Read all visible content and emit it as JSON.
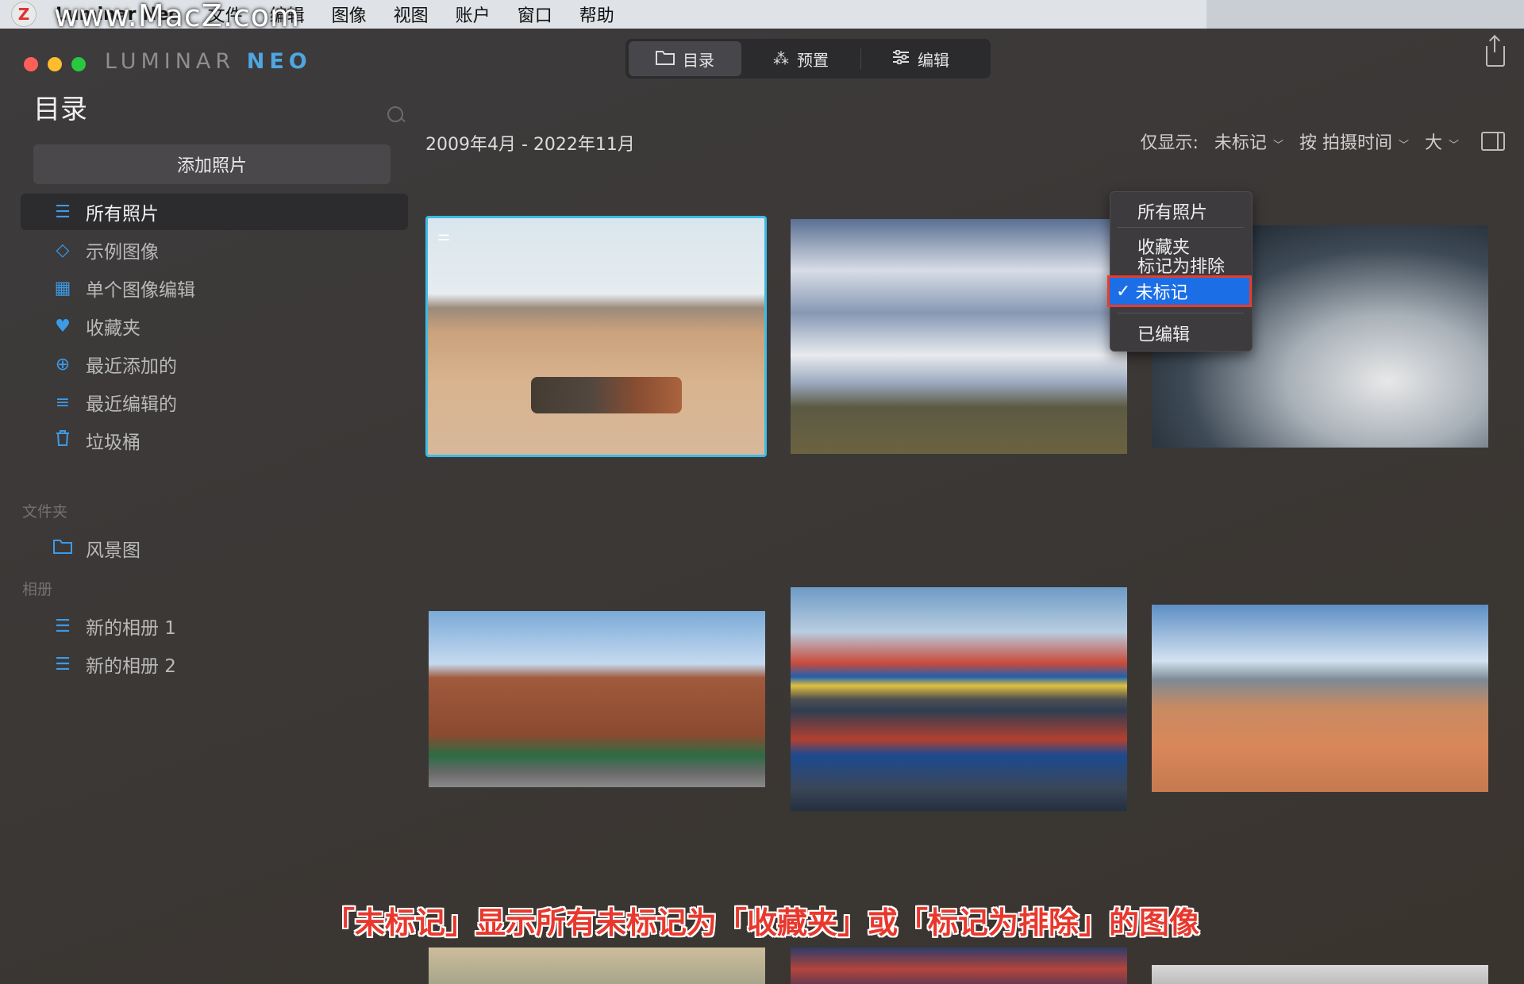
{
  "menubar": {
    "app_name": "Luminar Neo",
    "items": [
      "文件",
      "编辑",
      "图像",
      "视图",
      "账户",
      "窗口",
      "帮助"
    ]
  },
  "watermark": "www.MacZ.com",
  "brand": {
    "text": "LUMINAR",
    "accent": "NEO"
  },
  "topnav": {
    "catalog": "目录",
    "presets": "预置",
    "edit": "编辑"
  },
  "sidebar": {
    "title": "目录",
    "add_button": "添加照片",
    "items": [
      {
        "label": "所有照片",
        "icon": "stack-icon"
      },
      {
        "label": "示例图像",
        "icon": "graduation-cap-icon"
      },
      {
        "label": "单个图像编辑",
        "icon": "grid-icon"
      },
      {
        "label": "收藏夹",
        "icon": "heart-icon"
      },
      {
        "label": "最近添加的",
        "icon": "plus-circle-icon"
      },
      {
        "label": "最近编辑的",
        "icon": "sliders-icon"
      },
      {
        "label": "垃圾桶",
        "icon": "trash-icon"
      }
    ],
    "folders_label": "文件夹",
    "folders": [
      {
        "label": "风景图",
        "icon": "folder-icon"
      }
    ],
    "albums_label": "相册",
    "albums": [
      {
        "label": "新的相册 1",
        "icon": "album-icon"
      },
      {
        "label": "新的相册 2",
        "icon": "album-icon"
      }
    ]
  },
  "main": {
    "date_range": "2009年4月 - 2022年11月",
    "show_only_label": "仅显示:",
    "show_only_value": "未标记",
    "sort_label": "按 拍摄时间",
    "size_label": "大"
  },
  "dropdown": {
    "items": [
      "所有照片",
      "收藏夹",
      "标记为排除",
      "未标记",
      "已编辑"
    ],
    "selected": "未标记",
    "check": "✓"
  },
  "thumbnails": [
    {
      "name": "cows-desert",
      "selected": true,
      "edited": true
    },
    {
      "name": "clouds-field"
    },
    {
      "name": "smoke"
    },
    {
      "name": "brick-street"
    },
    {
      "name": "colorful-houses-reflection"
    },
    {
      "name": "canyon-landscape"
    }
  ],
  "caption": "「未标记」显示所有未标记为「收藏夹」或「标记为排除」的图像",
  "colors": {
    "accent": "#3c9be8",
    "selected_blue": "#1c6ee6",
    "highlight_red": "#e73c2c",
    "selection_border": "#3cbbe6"
  }
}
